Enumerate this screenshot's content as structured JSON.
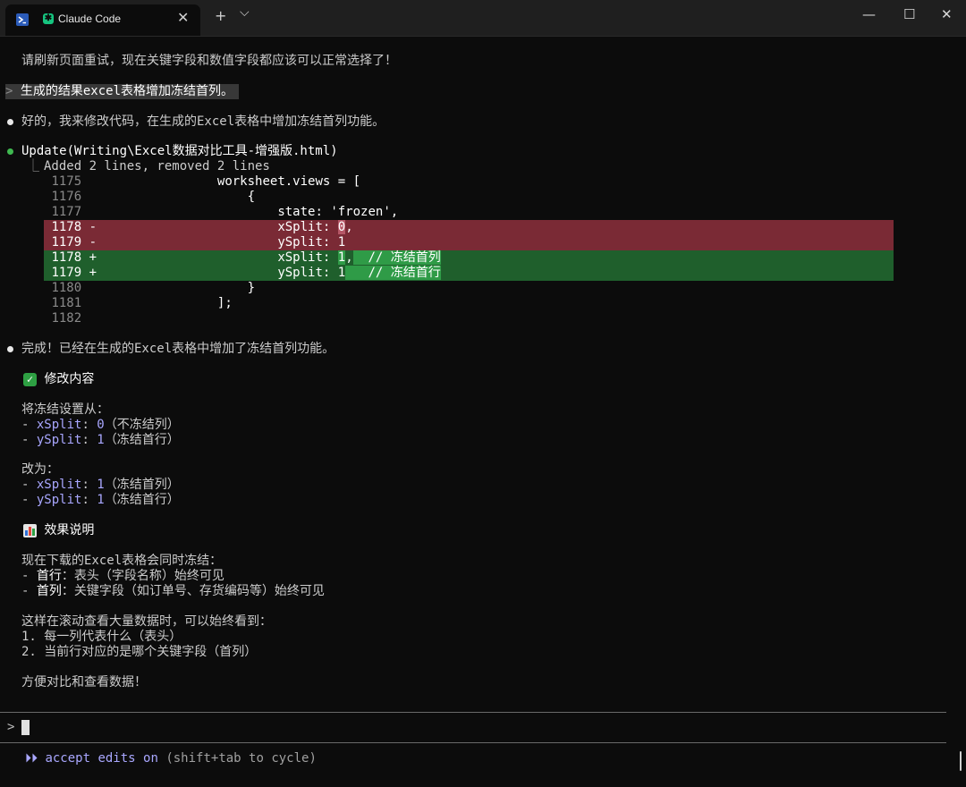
{
  "window": {
    "tab_title": "Claude Code",
    "tab_close": "✕",
    "new_tab": "+",
    "tab_menu": "⌵",
    "minimize": "—",
    "maximize": "☐",
    "close": "✕"
  },
  "colors": {
    "background": "#0c0c0c",
    "diff_removed": "#7a2a35",
    "diff_added": "#1f5f2c",
    "bullet_success": "#3fb950",
    "keyword": "#a9a7ff"
  },
  "conversation": {
    "line1": "请刷新页面重试，现在关键字段和数值字段都应该可以正常选择了！",
    "user_prompt_marker": ">",
    "user_prompt": "生成的结果excel表格增加冻结首列。",
    "reply1": "好的，我来修改代码，在生成的Excel表格中增加冻结首列功能。",
    "tool_call": "Update(Writing\\Excel数据对比工具-增强版.html)",
    "tool_result_branch": "⎿",
    "tool_result": "Added 2 lines, removed 2 lines",
    "diff": [
      {
        "num": "1175",
        "sign": " ",
        "code": "                worksheet.views = ["
      },
      {
        "num": "1176",
        "sign": " ",
        "code": "                    {"
      },
      {
        "num": "1177",
        "sign": " ",
        "code": "                        state: 'frozen',"
      },
      {
        "num": "1178",
        "sign": "-",
        "code_a": "                        xSplit: ",
        "hl": "0",
        "code_b": ","
      },
      {
        "num": "1179",
        "sign": "-",
        "code_a": "                        ySplit: 1",
        "hl": "",
        "code_b": ""
      },
      {
        "num": "1178",
        "sign": "+",
        "code_a": "                        xSplit: ",
        "hl": "1",
        "code_mid": ",",
        "hl2": "  // 冻结首列"
      },
      {
        "num": "1179",
        "sign": "+",
        "code_a": "                        ySplit: 1",
        "hl": "",
        "code_mid": "",
        "hl2": "   // 冻结首行"
      },
      {
        "num": "1180",
        "sign": " ",
        "code": "                    }"
      },
      {
        "num": "1181",
        "sign": " ",
        "code": "                ];"
      },
      {
        "num": "1182",
        "sign": " ",
        "code": ""
      }
    ],
    "reply2": "完成！已经在生成的Excel表格中增加了冻结首列功能。",
    "section1_icon": "check-icon",
    "section1_title": "修改内容",
    "from_label": "将冻结设置从：",
    "from_items": [
      {
        "dash": "- ",
        "key": "xSplit",
        "sep": ": ",
        "val": "0",
        "note": "（不冻结列）"
      },
      {
        "dash": "- ",
        "key": "ySplit",
        "sep": ": ",
        "val": "1",
        "note": "（冻结首行）"
      }
    ],
    "to_label": "改为：",
    "to_items": [
      {
        "dash": "- ",
        "key": "xSplit",
        "sep": ": ",
        "val": "1",
        "note": "（冻结首列）"
      },
      {
        "dash": "- ",
        "key": "ySplit",
        "sep": ": ",
        "val": "1",
        "note": "（冻结首行）"
      }
    ],
    "section2_icon": "bar-chart-icon",
    "section2_title": "效果说明",
    "effect_intro": "现在下载的Excel表格会同时冻结：",
    "effect_items": [
      {
        "dash": "- ",
        "key": "首行",
        "rest": "：表头（字段名称）始终可见"
      },
      {
        "dash": "- ",
        "key": "首列",
        "rest": "：关键字段（如订单号、存货编码等）始终可见"
      }
    ],
    "scroll_intro": "这样在滚动查看大量数据时，可以始终看到：",
    "scroll_items": [
      "1. 每一列代表什么（表头）",
      "2. 当前行对应的是哪个关键字段（首列）"
    ],
    "closing": "方便对比和查看数据！"
  },
  "input": {
    "prompt": ">",
    "value": ""
  },
  "status": {
    "icon": "⏵⏵",
    "mode": "accept edits on",
    "hint": "(shift+tab to cycle)"
  }
}
